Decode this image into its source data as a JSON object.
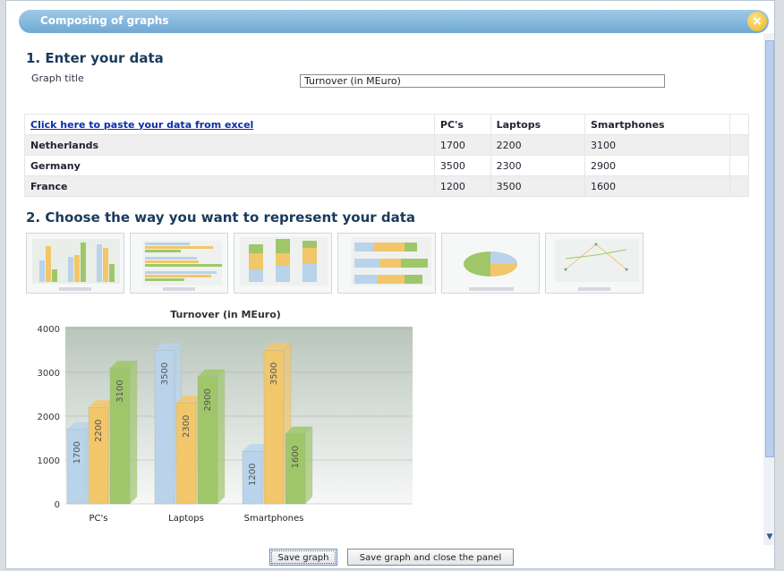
{
  "dialog": {
    "title": "Composing of graphs",
    "close_symbol": "×"
  },
  "section1": {
    "heading": "1. Enter your data",
    "graph_title_label": "Graph title",
    "graph_title_value": "Turnover (in MEuro)"
  },
  "table": {
    "paste_link": "Click here to paste your data from excel",
    "columns": [
      "PC's",
      "Laptops",
      "Smartphones"
    ],
    "rows": [
      {
        "name": "Netherlands",
        "values": [
          "1700",
          "2200",
          "3100"
        ]
      },
      {
        "name": "Germany",
        "values": [
          "3500",
          "2300",
          "2900"
        ]
      },
      {
        "name": "France",
        "values": [
          "1200",
          "3500",
          "1600"
        ]
      }
    ]
  },
  "section2": {
    "heading": "2. Choose the way you want to represent your data"
  },
  "chart_types": [
    "column-3d",
    "bar-horizontal",
    "stacked-column",
    "stacked-bar",
    "pie",
    "line"
  ],
  "chart_data": {
    "type": "bar",
    "title": "Turnover (in MEuro)",
    "categories": [
      "PC's",
      "Laptops",
      "Smartphones"
    ],
    "series": [
      {
        "values": [
          1700,
          3500,
          1200
        ],
        "color": "#b9d3ea"
      },
      {
        "values": [
          2200,
          2300,
          3500
        ],
        "color": "#f2c66a"
      },
      {
        "values": [
          3100,
          2900,
          1600
        ],
        "color": "#9fc76a"
      }
    ],
    "ylim": [
      0,
      4000
    ],
    "yticks": [
      0,
      1000,
      2000,
      3000,
      4000
    ],
    "grid": true
  },
  "buttons": {
    "save": "Save graph",
    "save_close": "Save graph and close the panel"
  }
}
